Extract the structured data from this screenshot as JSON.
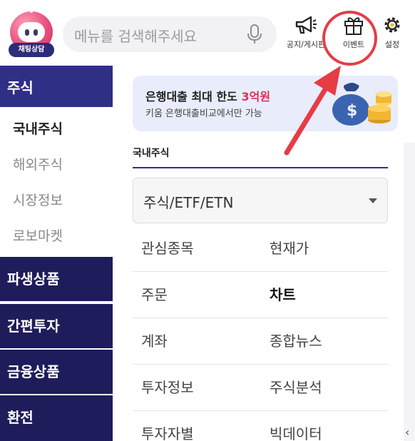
{
  "header": {
    "chatbot_label": "채팅상담",
    "search_placeholder": "메뉴를 검색해주세요",
    "icons": {
      "notice": "공지/게시판",
      "event": "이벤트",
      "settings": "설정"
    }
  },
  "leftnav": {
    "active_main": "주식",
    "sub_items": [
      "국내주식",
      "해외주식",
      "시장정보",
      "로보마켓"
    ],
    "other_mains": [
      "파생상품",
      "간편투자",
      "금융상품",
      "환전"
    ]
  },
  "banner": {
    "title_prefix": "은행대출 최대 한도 ",
    "title_highlight": "3억원",
    "subtitle": "키움 은행대출비교에서만 가능"
  },
  "section": {
    "label": "국내주식",
    "select_value": "주식/ETF/ETN"
  },
  "menu_rows": [
    [
      "관심종목",
      "현재가"
    ],
    [
      "주문",
      "차트"
    ],
    [
      "계좌",
      "종합뉴스"
    ],
    [
      "투자정보",
      "주식분석"
    ],
    [
      "투자자별",
      "빅데이터"
    ]
  ],
  "colors": {
    "nav_dark": "#1e1c5a",
    "nav_active": "#2f2f85",
    "accent_red": "#e63c46",
    "banner_bg": "#e9ecfa"
  }
}
